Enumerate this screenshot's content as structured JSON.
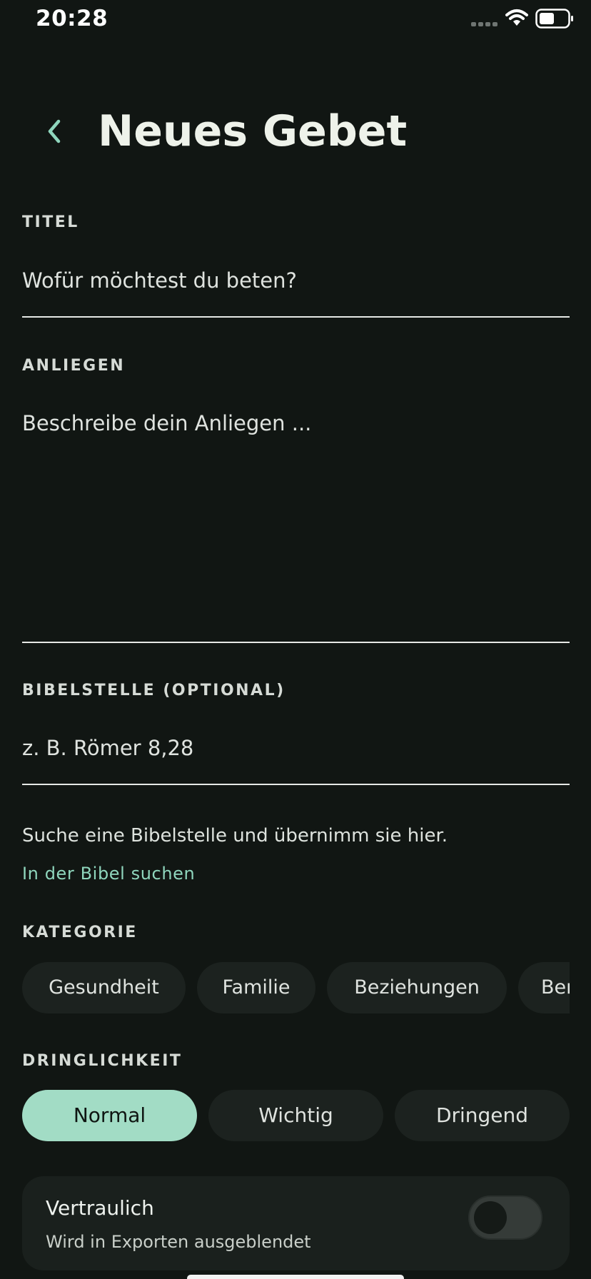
{
  "status_bar": {
    "time": "20:28"
  },
  "header": {
    "title": "Neues Gebet"
  },
  "form": {
    "title_label": "TITEL",
    "title_placeholder": "Wofür möchtest du beten?",
    "title_value": "",
    "request_label": "ANLIEGEN",
    "request_placeholder": "Beschreibe dein Anliegen ...",
    "request_value": "",
    "verse_label": "BIBELSTELLE (OPTIONAL)",
    "verse_placeholder": "z. B. Römer 8,28",
    "verse_value": "",
    "verse_helper": "Suche eine Bibelstelle und übernimm sie hier.",
    "verse_link": "In der Bibel suchen"
  },
  "category": {
    "label": "KATEGORIE",
    "chips": [
      "Gesundheit",
      "Familie",
      "Beziehungen",
      "Beruf"
    ]
  },
  "urgency": {
    "label": "DRINGLICHKEIT",
    "options": [
      "Normal",
      "Wichtig",
      "Dringend"
    ],
    "selected": "Normal"
  },
  "confidential": {
    "title": "Vertraulich",
    "subtitle": "Wird in Exporten ausgeblendet",
    "enabled": false
  },
  "colors": {
    "background": "#111613",
    "accent": "#8fd6bd",
    "selected_segment": "#a2dcc5",
    "chip": "#1c221f",
    "card": "#1a201d"
  },
  "icons": {
    "back": "chevron-left-icon",
    "signal": "cellular-signal-icon",
    "wifi": "wifi-icon",
    "battery": "battery-icon"
  }
}
